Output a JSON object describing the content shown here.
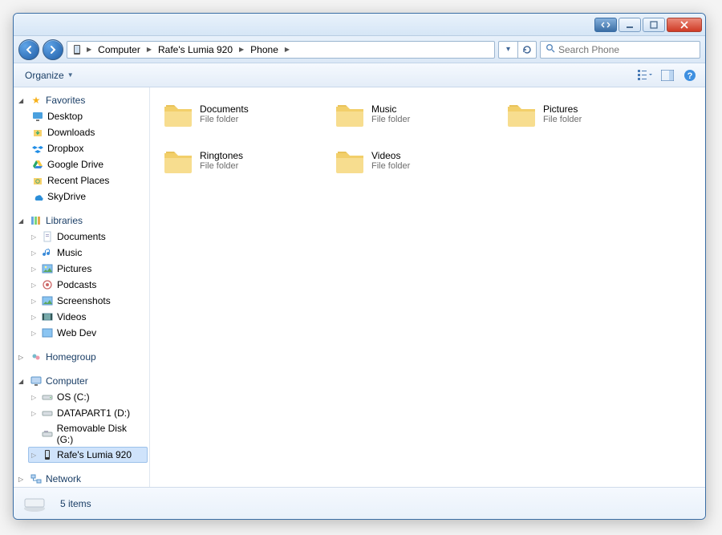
{
  "titlebar": {},
  "nav": {
    "breadcrumbs": [
      "Computer",
      "Rafe's Lumia 920",
      "Phone"
    ],
    "search_placeholder": "Search Phone"
  },
  "toolbar": {
    "organize_label": "Organize"
  },
  "sidebar": {
    "favorites": {
      "label": "Favorites",
      "items": [
        "Desktop",
        "Downloads",
        "Dropbox",
        "Google Drive",
        "Recent Places",
        "SkyDrive"
      ]
    },
    "libraries": {
      "label": "Libraries",
      "items": [
        "Documents",
        "Music",
        "Pictures",
        "Podcasts",
        "Screenshots",
        "Videos",
        "Web Dev"
      ]
    },
    "homegroup": {
      "label": "Homegroup"
    },
    "computer": {
      "label": "Computer",
      "items": [
        "OS (C:)",
        "DATAPART1 (D:)",
        "Removable Disk (G:)",
        "Rafe's Lumia 920"
      ]
    },
    "network": {
      "label": "Network"
    }
  },
  "content": {
    "folders": [
      {
        "name": "Documents",
        "type": "File folder"
      },
      {
        "name": "Music",
        "type": "File folder"
      },
      {
        "name": "Pictures",
        "type": "File folder"
      },
      {
        "name": "Ringtones",
        "type": "File folder"
      },
      {
        "name": "Videos",
        "type": "File folder"
      }
    ]
  },
  "status": {
    "count_text": "5 items"
  }
}
